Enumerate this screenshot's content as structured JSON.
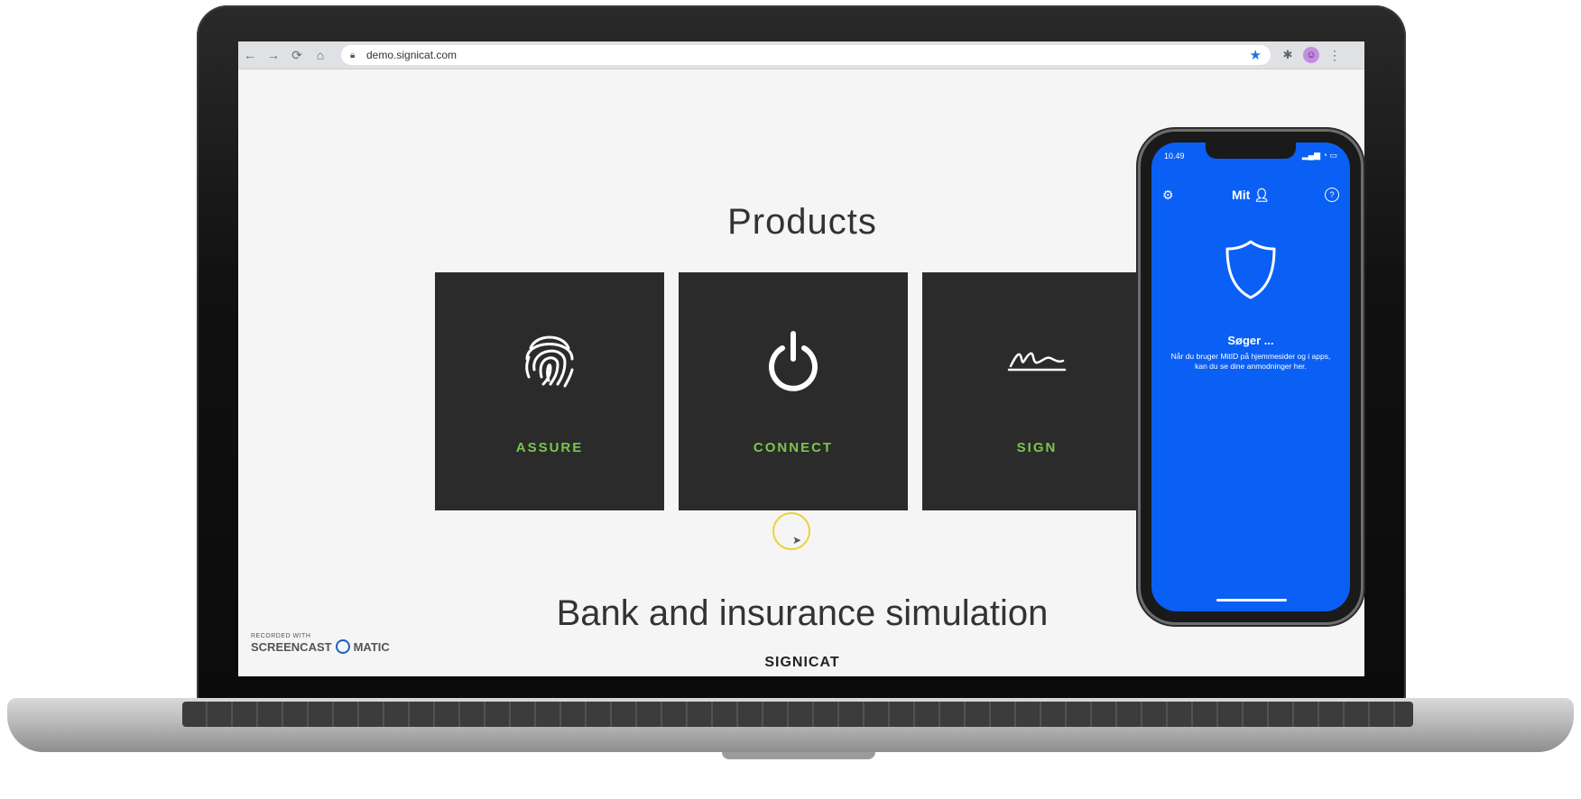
{
  "browser": {
    "url": "demo.signicat.com",
    "nav_icons": [
      "back-icon",
      "forward-icon",
      "reload-icon",
      "home-icon"
    ]
  },
  "page": {
    "products_title": "Products",
    "tiles": [
      {
        "label": "ASSURE",
        "icon": "fingerprint-icon"
      },
      {
        "label": "CONNECT",
        "icon": "power-icon"
      },
      {
        "label": "SIGN",
        "icon": "signature-icon"
      }
    ],
    "bank_title": "Bank and insurance simulation",
    "footer_logo": "SIGNICAT"
  },
  "watermark": {
    "small": "RECORDED WITH",
    "left": "SCREENCAST",
    "right": "MATIC"
  },
  "phone": {
    "time": "10.49",
    "app_name": "Mit",
    "title": "Søger ...",
    "text": "Når du bruger MitID på hjemmesider og i apps, kan du se dine anmodninger her."
  },
  "colors": {
    "tile_bg": "#2b2b2b",
    "tile_label": "#79c74a",
    "phone_bg": "#0a5ff5"
  }
}
